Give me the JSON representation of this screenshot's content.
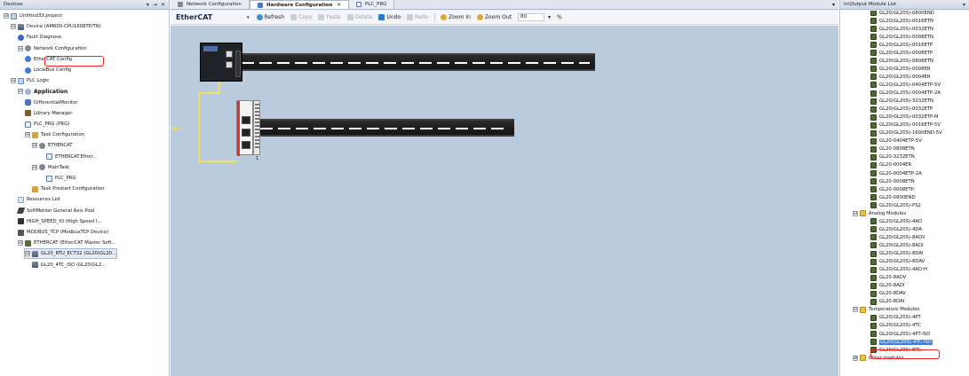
{
  "left_panel": {
    "title": "Devices",
    "controls": [
      "▾",
      "⇥",
      "✕"
    ],
    "items": [
      {
        "label": "Untitled33.project",
        "icon": "project-icon",
        "expander": "⊟"
      },
      {
        "label": "Device (AM600-CPU1608TP/TN)",
        "icon": "device-icon",
        "expander": "⊟"
      },
      {
        "label": "Fault Diagnose",
        "icon": "fault-diagnose-icon"
      },
      {
        "label": "Network Configuration",
        "icon": "network-config-icon",
        "expander": "⊟"
      },
      {
        "label": "EtherCAT Config",
        "icon": "ethercat-config-icon"
      },
      {
        "label": "LocalBus Config",
        "icon": "localbus-config-icon"
      },
      {
        "label": "PLC Logic",
        "icon": "plc-logic-icon",
        "expander": "⊟"
      },
      {
        "label": "Application",
        "icon": "application-icon",
        "expander": "⊟"
      },
      {
        "label": "DifferentialMonitor",
        "icon": "differential-monitor-icon"
      },
      {
        "label": "Library Manager",
        "icon": "library-manager-icon"
      },
      {
        "label": "PLC_PRG (PRG)",
        "icon": "program-icon"
      },
      {
        "label": "Task Configuration",
        "icon": "task-config-icon",
        "expander": "⊟"
      },
      {
        "label": "ETHERCAT",
        "icon": "task-gear-icon",
        "expander": "⊟"
      },
      {
        "label": "ETHERCAT.Ether...",
        "icon": "task-call-icon"
      },
      {
        "label": "MainTask",
        "icon": "task-gear-icon",
        "expander": "⊟"
      },
      {
        "label": "PLC_PRG",
        "icon": "task-call-icon"
      },
      {
        "label": "Task Prestart Configuration",
        "icon": "prestart-icon"
      },
      {
        "label": "Resources List",
        "icon": "resources-icon"
      },
      {
        "label": "SoftMotion General Axis Pool",
        "icon": "axis-pool-icon"
      },
      {
        "label": "HIGH_SPEED_IO (High Speed I...",
        "icon": "high-speed-io-icon"
      },
      {
        "label": "MODBUS_TCP (ModbusTCP Device)",
        "icon": "modbus-icon"
      },
      {
        "label": "ETHERCAT (EtherCAT Master Soft...",
        "icon": "ethercat-master-icon",
        "expander": "⊟"
      },
      {
        "label": "GL20_RTU_ECT32 (GL20(GL20...",
        "icon": "module-icon",
        "expander": "⊟"
      },
      {
        "label": "GL20_4TC_ISO (GL20(GL2...",
        "icon": "module-icon"
      }
    ]
  },
  "center": {
    "tabs": [
      {
        "label": "Network Configuration"
      },
      {
        "label": "Hardware Configuration",
        "close": "✕"
      },
      {
        "label": "PLC_PRG"
      }
    ],
    "tab_dropdown": "▾",
    "toolbar": {
      "network": "EtherCAT",
      "network_caret": "▾",
      "refresh": "Refresh",
      "copy": "Copy",
      "paste": "Paste",
      "delete": "Delete",
      "undo": "Undo",
      "redo": "Redo",
      "zoom_in": "Zoom In",
      "zoom_out": "Zoom Out",
      "zoom_value": "80",
      "zoom_caret": "▾",
      "zoom_unit": "%"
    },
    "canvas": {
      "station_label": "No 1",
      "slot_label": "1"
    }
  },
  "right_panel": {
    "title": "In\\Output Module List",
    "control": "▾",
    "items": [
      {
        "label": "GL20(GL20S)-0800END",
        "kind": "module"
      },
      {
        "label": "GL20(GL20S)-0016ETN",
        "kind": "module"
      },
      {
        "label": "GL20(GL20S)-0032ETN",
        "kind": "module"
      },
      {
        "label": "GL20(GL20S)-0008ETN",
        "kind": "module"
      },
      {
        "label": "GL20(GL20S)-0016ETP",
        "kind": "module"
      },
      {
        "label": "GL20(GL20S)-0008ETP",
        "kind": "module"
      },
      {
        "label": "GL20(GL20S)-0808ETN",
        "kind": "module"
      },
      {
        "label": "GL20(GL20S)-0008ER",
        "kind": "module"
      },
      {
        "label": "GL20(GL20S)-0004ER",
        "kind": "module"
      },
      {
        "label": "GL20(GL20S)-0404ETP-5V",
        "kind": "module"
      },
      {
        "label": "GL20(GL20S)-0004ETP-2A",
        "kind": "module"
      },
      {
        "label": "GL20(GL20S)-3232ETN",
        "kind": "module"
      },
      {
        "label": "GL20(GL20S)-0032ETP",
        "kind": "module"
      },
      {
        "label": "GL20(GL20S)-0032ETP-M",
        "kind": "module"
      },
      {
        "label": "GL20(GL20S)-0016ETP-5V",
        "kind": "module"
      },
      {
        "label": "GL20(GL20S)-1600END-5V",
        "kind": "module"
      },
      {
        "label": "GL20-0404ETP-5V",
        "kind": "module"
      },
      {
        "label": "GL20-0808ETN",
        "kind": "module"
      },
      {
        "label": "GL20-3232ETN",
        "kind": "module"
      },
      {
        "label": "GL20-0004ER",
        "kind": "module"
      },
      {
        "label": "GL20-0004ETP-2A",
        "kind": "module"
      },
      {
        "label": "GL20-0008ETN",
        "kind": "module"
      },
      {
        "label": "GL20-0008ETP",
        "kind": "module"
      },
      {
        "label": "GL20-0800END",
        "kind": "module"
      },
      {
        "label": "GL20(GL20S)-PS2",
        "kind": "module"
      },
      {
        "label": "Analog Modules",
        "kind": "folder",
        "expander": "⊟"
      },
      {
        "label": "GL20(GL20S)-4AD",
        "kind": "module"
      },
      {
        "label": "GL20(GL20S)-4DA",
        "kind": "module"
      },
      {
        "label": "GL20(GL20S)-8ADV",
        "kind": "module"
      },
      {
        "label": "GL20(GL20S)-8ADI",
        "kind": "module"
      },
      {
        "label": "GL20(GL20S)-8DAI",
        "kind": "module"
      },
      {
        "label": "GL20(GL20S)-8DAV",
        "kind": "module"
      },
      {
        "label": "GL20(GL20S)-4AD-H",
        "kind": "module"
      },
      {
        "label": "GL20-8ADV",
        "kind": "module"
      },
      {
        "label": "GL20-8ADI",
        "kind": "module"
      },
      {
        "label": "GL20-8DAV",
        "kind": "module"
      },
      {
        "label": "GL20-8DAI",
        "kind": "module"
      },
      {
        "label": "Temperature Modules",
        "kind": "folder",
        "expander": "⊟"
      },
      {
        "label": "GL20(GL20S)-4PT",
        "kind": "module"
      },
      {
        "label": "GL20(GL20S)-4TC",
        "kind": "module"
      },
      {
        "label": "GL20(GL20S)-4PT-ISO",
        "kind": "module"
      },
      {
        "label": "GL20(GL20S)-4TC-ISO",
        "kind": "module",
        "selected": true
      },
      {
        "label": "GL20(GL20S)-8TC",
        "kind": "module"
      },
      {
        "label": "Other modules",
        "kind": "folder",
        "expander": "⊞"
      }
    ]
  },
  "colors": {
    "canvas_bg": "#b9cbdd",
    "highlight_box": "#e22222",
    "selection": "#3b7ed9",
    "link_wire": "#f0e25a"
  }
}
